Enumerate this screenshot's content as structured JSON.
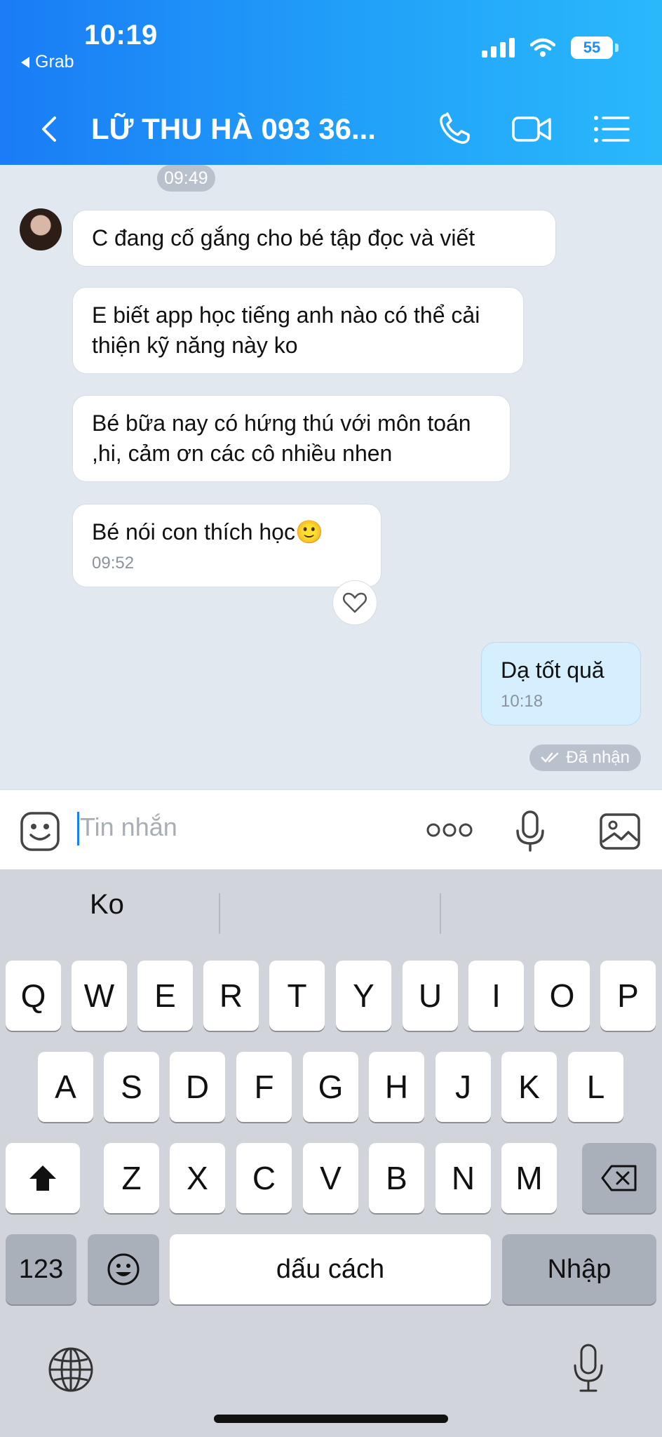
{
  "status_bar": {
    "time": "10:19",
    "back_app": "Grab",
    "battery": "55"
  },
  "header": {
    "title": "LỮ THU HÀ 093 36..."
  },
  "chat": {
    "time_separator": "09:49",
    "messages": [
      {
        "from": "them",
        "text": "C đang cố gắng cho bé tập đọc và viết"
      },
      {
        "from": "them",
        "text": "E biết app học tiếng anh nào có thể cải thiện kỹ năng này ko"
      },
      {
        "from": "them",
        "text": "Bé bữa nay có hứng thú với môn toán ,hi, cảm ơn các cô nhiều nhen"
      },
      {
        "from": "them",
        "text": "Bé nói con thích học🙂",
        "time": "09:52"
      },
      {
        "from": "me",
        "text": "Dạ tốt quă",
        "time": "10:18"
      }
    ],
    "receipt": "Đã nhận"
  },
  "input": {
    "placeholder": "Tin nhắn"
  },
  "keyboard": {
    "suggestions": [
      "Ko",
      "",
      ""
    ],
    "row1": [
      "Q",
      "W",
      "E",
      "R",
      "T",
      "Y",
      "U",
      "I",
      "O",
      "P"
    ],
    "row2": [
      "A",
      "S",
      "D",
      "F",
      "G",
      "H",
      "J",
      "K",
      "L"
    ],
    "row3": [
      "Z",
      "X",
      "C",
      "V",
      "B",
      "N",
      "M"
    ],
    "numbers_key": "123",
    "space_key": "dấu cách",
    "return_key": "Nhập"
  },
  "colors": {
    "header_start": "#1a7cf6",
    "header_end": "#2ab8fb",
    "my_bubble": "#d6efff",
    "chat_bg": "#e1e8ef"
  }
}
